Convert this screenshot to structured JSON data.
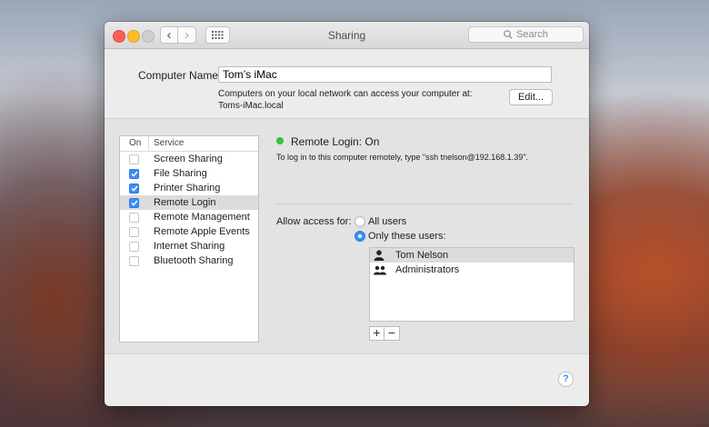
{
  "window": {
    "title": "Sharing"
  },
  "toolbar": {
    "search_placeholder": "Search",
    "back_label": "‹",
    "forward_label": "›"
  },
  "computer": {
    "name_label": "Computer Name:",
    "name_value": "Tom’s iMac",
    "desc_line1": "Computers on your local network can access your computer at:",
    "desc_line2": "Toms-iMac.local",
    "edit_label": "Edit..."
  },
  "services": {
    "header_on": "On",
    "header_service": "Service",
    "items": [
      {
        "label": "Screen Sharing",
        "checked": false,
        "selected": false
      },
      {
        "label": "File Sharing",
        "checked": true,
        "selected": false
      },
      {
        "label": "Printer Sharing",
        "checked": true,
        "selected": false
      },
      {
        "label": "Remote Login",
        "checked": true,
        "selected": true
      },
      {
        "label": "Remote Management",
        "checked": false,
        "selected": false
      },
      {
        "label": "Remote Apple Events",
        "checked": false,
        "selected": false
      },
      {
        "label": "Internet Sharing",
        "checked": false,
        "selected": false
      },
      {
        "label": "Bluetooth Sharing",
        "checked": false,
        "selected": false
      }
    ]
  },
  "detail": {
    "status": "Remote Login: On",
    "status_color": "#34c23d",
    "description": "To log in to this computer remotely, type \"ssh tnelson@192.168.1.39\".",
    "allow_label": "Allow access for:",
    "option_all": "All users",
    "option_only": "Only these users:",
    "selected_option": "Only these users:",
    "users": [
      {
        "name": "Tom Nelson",
        "icon": "user-icon",
        "selected": true
      },
      {
        "name": "Administrators",
        "icon": "group-icon",
        "selected": false
      }
    ],
    "add_label": "+",
    "remove_label": "−"
  },
  "help": {
    "label": "?"
  },
  "colors": {
    "accent": "#3c8ef5",
    "selection": "#dcdcdc"
  }
}
